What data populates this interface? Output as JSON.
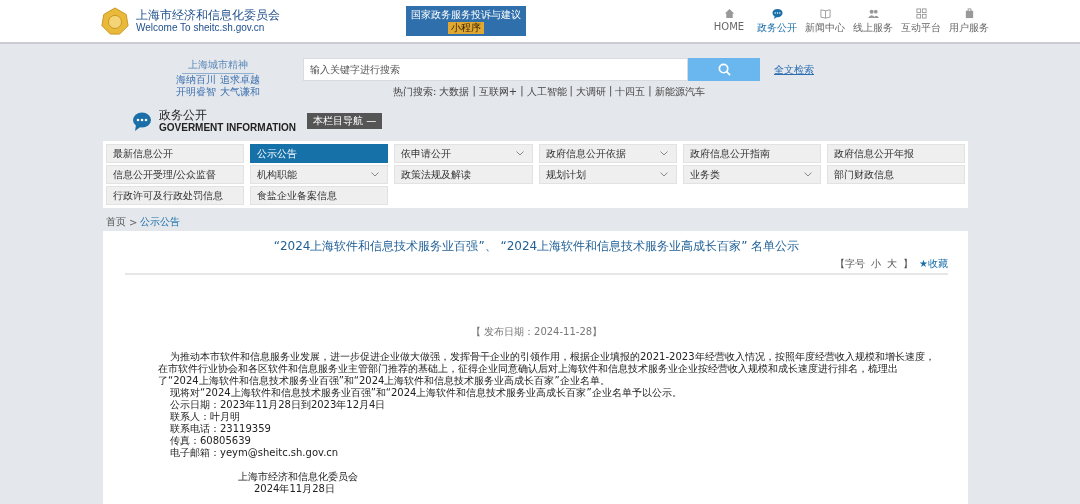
{
  "header": {
    "title": "上海市经济和信息化委员会",
    "subtitle": "Welcome To sheitc.sh.gov.cn",
    "banner": {
      "title": "国家政务服务投诉与建议",
      "tag": "小程序"
    },
    "nav": [
      {
        "label": "HOME",
        "kind": "home",
        "selected": false
      },
      {
        "label": "政务公开",
        "kind": "chat",
        "selected": true
      },
      {
        "label": "新闻中心",
        "kind": "book",
        "selected": false
      },
      {
        "label": "线上服务",
        "kind": "people",
        "selected": false
      },
      {
        "label": "互动平台",
        "kind": "grid",
        "selected": false
      },
      {
        "label": "用户服务",
        "kind": "user",
        "selected": false
      }
    ]
  },
  "spirit": {
    "title": "上海城市精神",
    "lines": [
      "海纳百川 追求卓越",
      "开明睿智 大气谦和"
    ]
  },
  "search": {
    "placeholder": "输入关键字进行搜索",
    "fulltext_link": "全文检索",
    "hot_label": "热门搜索:",
    "hot_separator": "|",
    "hot_terms": [
      "大数据",
      "互联网+",
      "人工智能",
      "大调研",
      "十四五",
      "新能源汽车"
    ]
  },
  "section": {
    "title": "政务公开",
    "subtitle": "GOVERMENT INFORMATION",
    "nav_button": "本栏目导航 —"
  },
  "menu": [
    {
      "label": "最新信息公开",
      "selected": false,
      "dropdown": false
    },
    {
      "label": "公示公告",
      "selected": true,
      "dropdown": false
    },
    {
      "label": "依申请公开",
      "selected": false,
      "dropdown": true
    },
    {
      "label": "政府信息公开依据",
      "selected": false,
      "dropdown": true
    },
    {
      "label": "政府信息公开指南",
      "selected": false,
      "dropdown": false
    },
    {
      "label": "政府信息公开年报",
      "selected": false,
      "dropdown": false
    },
    {
      "label": "信息公开受理/公众监督",
      "selected": false,
      "dropdown": false
    },
    {
      "label": "机构职能",
      "selected": false,
      "dropdown": true
    },
    {
      "label": "政策法规及解读",
      "selected": false,
      "dropdown": false
    },
    {
      "label": "规划计划",
      "selected": false,
      "dropdown": true
    },
    {
      "label": "业务类",
      "selected": false,
      "dropdown": true
    },
    {
      "label": "部门财政信息",
      "selected": false,
      "dropdown": false
    },
    {
      "label": "行政许可及行政处罚信息",
      "selected": false,
      "dropdown": false
    },
    {
      "label": "食盐企业备案信息",
      "selected": false,
      "dropdown": false
    }
  ],
  "breadcrumb": {
    "items": [
      "首页",
      "公示公告"
    ],
    "separator": ">"
  },
  "article": {
    "title": "“2024上海软件和信息技术服务业百强”、 “2024上海软件和信息技术服务业高成长百家” 名单公示",
    "font_label": "【字号",
    "font_small": "小",
    "font_large": "大",
    "font_close": "】",
    "favorite": "★收藏",
    "date": "【 发布日期：2024-11-28】",
    "paragraphs": [
      "为推动本市软件和信息服务业发展，进一步促进企业做大做强，发挥骨干企业的引领作用，根据企业填报的2021-2023年经营收入情况，按照年度经营收入规模和增长速度，在市软件行业协会和各区软件和信息服务业主管部门推荐的基础上，征得企业同意确认后对上海软件和信息技术服务业企业按经营收入规模和成长速度进行排名，梳理出了“2024上海软件和信息技术服务业百强”和“2024上海软件和信息技术服务业高成长百家”企业名单。",
      "现将对“2024上海软件和信息技术服务业百强”和“2024上海软件和信息技术服务业高成长百家”企业名单予以公示。",
      "公示日期：2023年11月28日到2023年12月4日",
      "联系人：叶月明",
      "联系电话：23119359",
      "传真：60805639",
      "电子邮箱：yeym@sheitc.sh.gov.cn"
    ],
    "signature": [
      "上海市经济和信息化委员会",
      "2024年11月28日"
    ]
  }
}
